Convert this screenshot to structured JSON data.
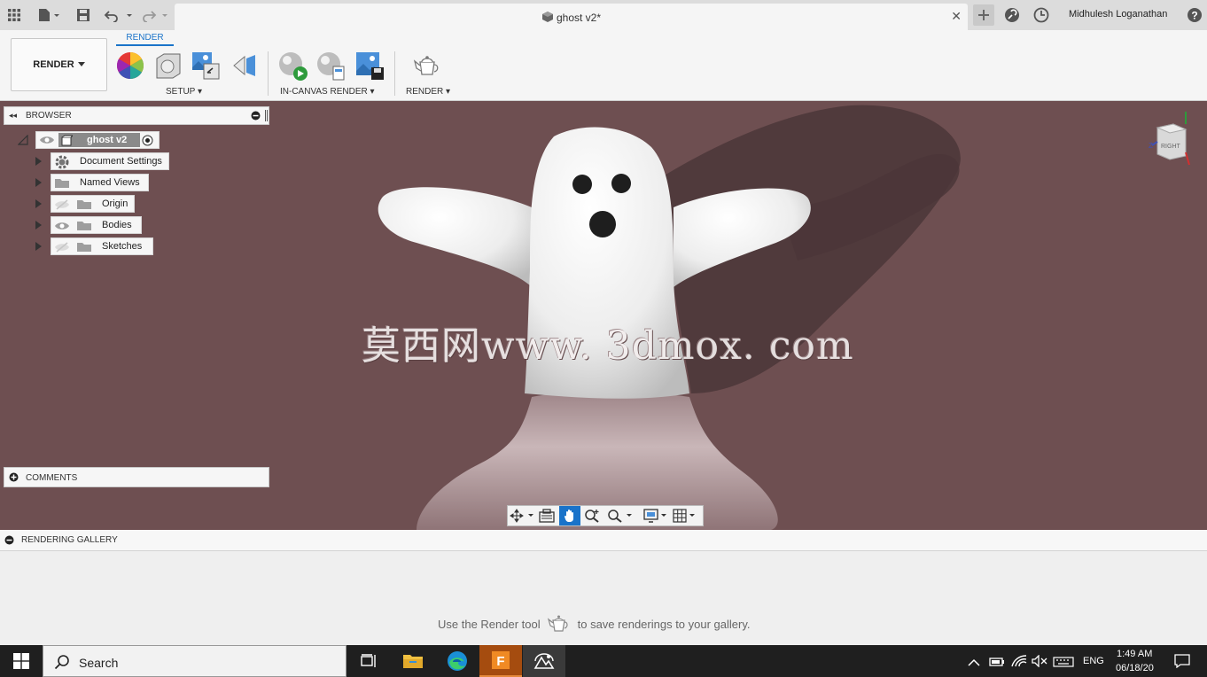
{
  "app": {
    "doc_title": "ghost v2*",
    "user_name": "Midhulesh Loganathan"
  },
  "ribbon": {
    "workspace": "RENDER",
    "tab": "RENDER",
    "groups": {
      "setup": "SETUP",
      "in_canvas": "IN-CANVAS RENDER",
      "render": "RENDER"
    }
  },
  "browser": {
    "title": "BROWSER",
    "root": "ghost v2",
    "items": [
      {
        "label": "Document Settings"
      },
      {
        "label": "Named Views"
      },
      {
        "label": "Origin"
      },
      {
        "label": "Bodies"
      },
      {
        "label": "Sketches"
      }
    ]
  },
  "comments": {
    "title": "COMMENTS"
  },
  "viewcube": {
    "face": "RIGHT",
    "axis_z": "Z"
  },
  "watermark": "莫西网www. 3dmox. com",
  "gallery": {
    "title": "RENDERING GALLERY",
    "msg_before": "Use the Render tool",
    "msg_after": "to save renderings to your gallery."
  },
  "taskbar": {
    "search": "Search",
    "language": "ENG",
    "time": "1:49 AM",
    "date": "06/18/20"
  },
  "colors": {
    "viewport": "#6e4f51",
    "accent": "#1a73c9"
  }
}
